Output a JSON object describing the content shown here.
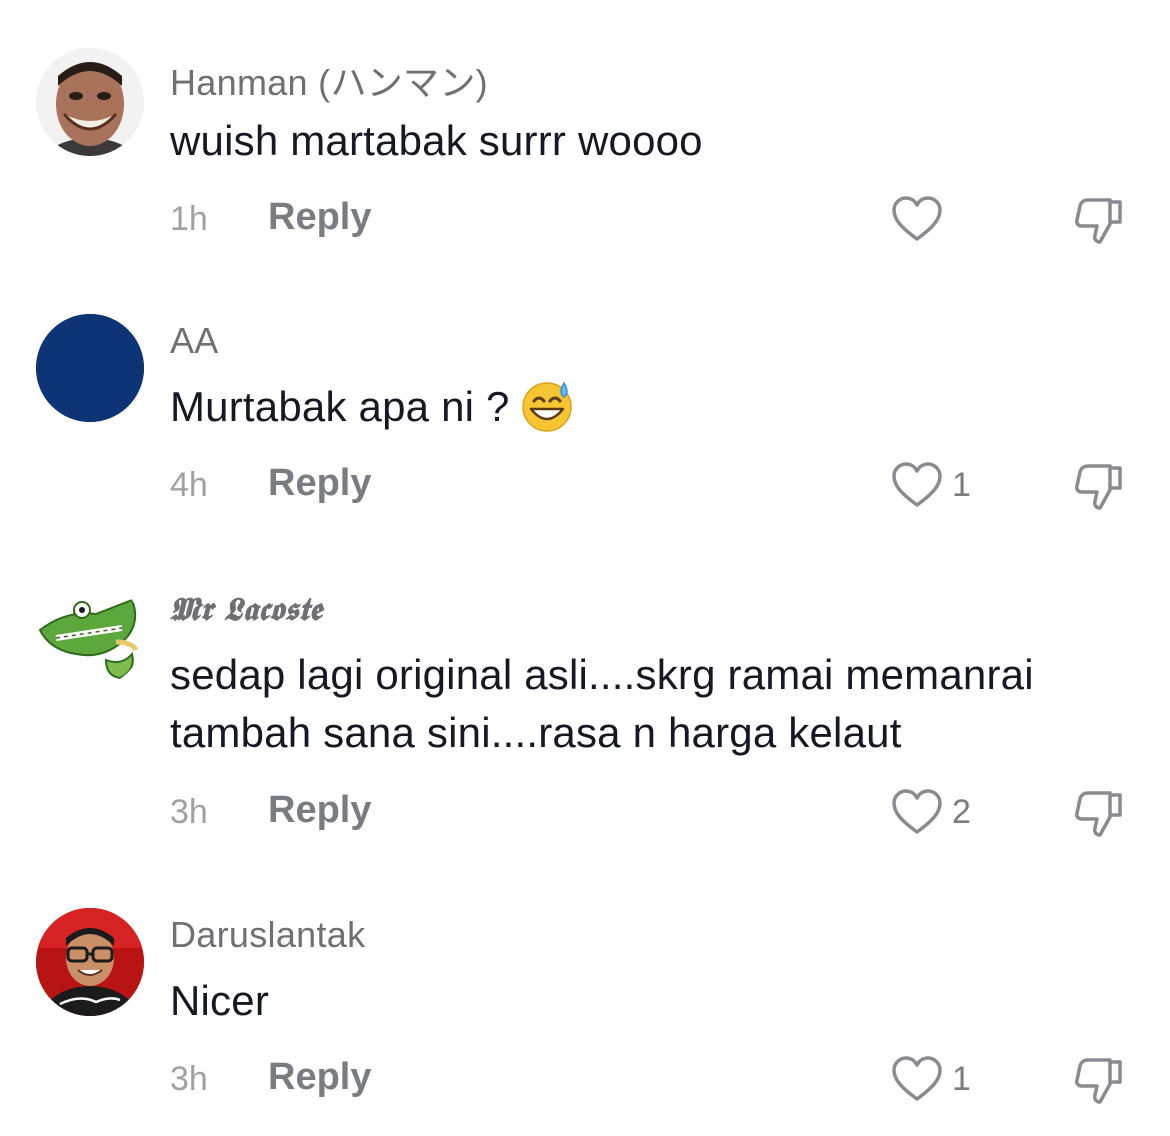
{
  "comments": [
    {
      "username": "Hanman (ハンマン)",
      "text": "wuish martabak surrr woooo",
      "time": "1h",
      "reply_label": "Reply",
      "likes": "",
      "avatar": "avatar-hanman"
    },
    {
      "username": "AA",
      "text": "Murtabak apa ni ?",
      "emoji": "grinning-sweat-emoji",
      "time": "4h",
      "reply_label": "Reply",
      "likes": "1",
      "avatar_color": "#0d3474"
    },
    {
      "username": "𝕸𝖗 𝕷𝖆𝖈𝖔𝖘𝖙𝖊",
      "text_line1": "sedap lagi original asli....skrg ramai memanrai",
      "text_line2": "tambah sana sini....rasa n harga kelaut",
      "time": "3h",
      "reply_label": "Reply",
      "likes": "2",
      "avatar": "avatar-crocodile"
    },
    {
      "username": "Daruslantak",
      "text": "Nicer",
      "time": "3h",
      "reply_label": "Reply",
      "likes": "1",
      "avatar": "avatar-daruslantak"
    }
  ],
  "icons": {
    "like": "heart-outline-icon",
    "dislike": "thumbs-down-outline-icon"
  },
  "colors": {
    "username": "#6f6f75",
    "text": "#161823",
    "meta": "#a0a0a6"
  }
}
